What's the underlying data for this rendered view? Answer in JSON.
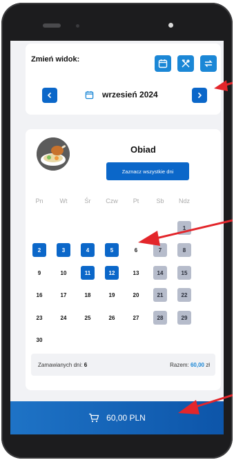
{
  "view_switch": {
    "label": "Zmień widok:",
    "icons": [
      "calendar-icon",
      "utensils-icon",
      "switch-icon"
    ]
  },
  "month_nav": {
    "prev_icon": "chevron-left-icon",
    "next_icon": "chevron-right-icon",
    "month": "wrzesień 2024"
  },
  "meal": {
    "title": "Obiad",
    "select_all": "Zaznacz wszystkie dni"
  },
  "weekdays": [
    "Pn",
    "Wt",
    "Śr",
    "Czw",
    "Pt",
    "Sb",
    "Ndz"
  ],
  "days": [
    {
      "n": "1",
      "s": "disabled"
    },
    {
      "n": "2",
      "s": "selected"
    },
    {
      "n": "3",
      "s": "selected"
    },
    {
      "n": "4",
      "s": "selected"
    },
    {
      "n": "5",
      "s": "selected"
    },
    {
      "n": "6",
      "s": "normal"
    },
    {
      "n": "7",
      "s": "disabled"
    },
    {
      "n": "8",
      "s": "disabled"
    },
    {
      "n": "9",
      "s": "normal"
    },
    {
      "n": "10",
      "s": "normal"
    },
    {
      "n": "11",
      "s": "selected"
    },
    {
      "n": "12",
      "s": "selected"
    },
    {
      "n": "13",
      "s": "normal"
    },
    {
      "n": "14",
      "s": "disabled"
    },
    {
      "n": "15",
      "s": "disabled"
    },
    {
      "n": "16",
      "s": "normal"
    },
    {
      "n": "17",
      "s": "normal"
    },
    {
      "n": "18",
      "s": "normal"
    },
    {
      "n": "19",
      "s": "normal"
    },
    {
      "n": "20",
      "s": "normal"
    },
    {
      "n": "21",
      "s": "disabled"
    },
    {
      "n": "22",
      "s": "disabled"
    },
    {
      "n": "23",
      "s": "normal"
    },
    {
      "n": "24",
      "s": "normal"
    },
    {
      "n": "25",
      "s": "normal"
    },
    {
      "n": "26",
      "s": "normal"
    },
    {
      "n": "27",
      "s": "normal"
    },
    {
      "n": "28",
      "s": "disabled"
    },
    {
      "n": "29",
      "s": "disabled"
    },
    {
      "n": "30",
      "s": "normal"
    }
  ],
  "summary": {
    "ordered_label": "Zamawianych dni:",
    "ordered_value": "6",
    "total_label": "Razem:",
    "total_value": "60,00",
    "currency": "zł"
  },
  "cart": {
    "icon": "cart-icon",
    "total": "60,00 PLN"
  },
  "colors": {
    "primary": "#0b67c9",
    "accent": "#1b87d6",
    "disabled_day": "#b6bccb",
    "arrow": "#e3262b"
  }
}
